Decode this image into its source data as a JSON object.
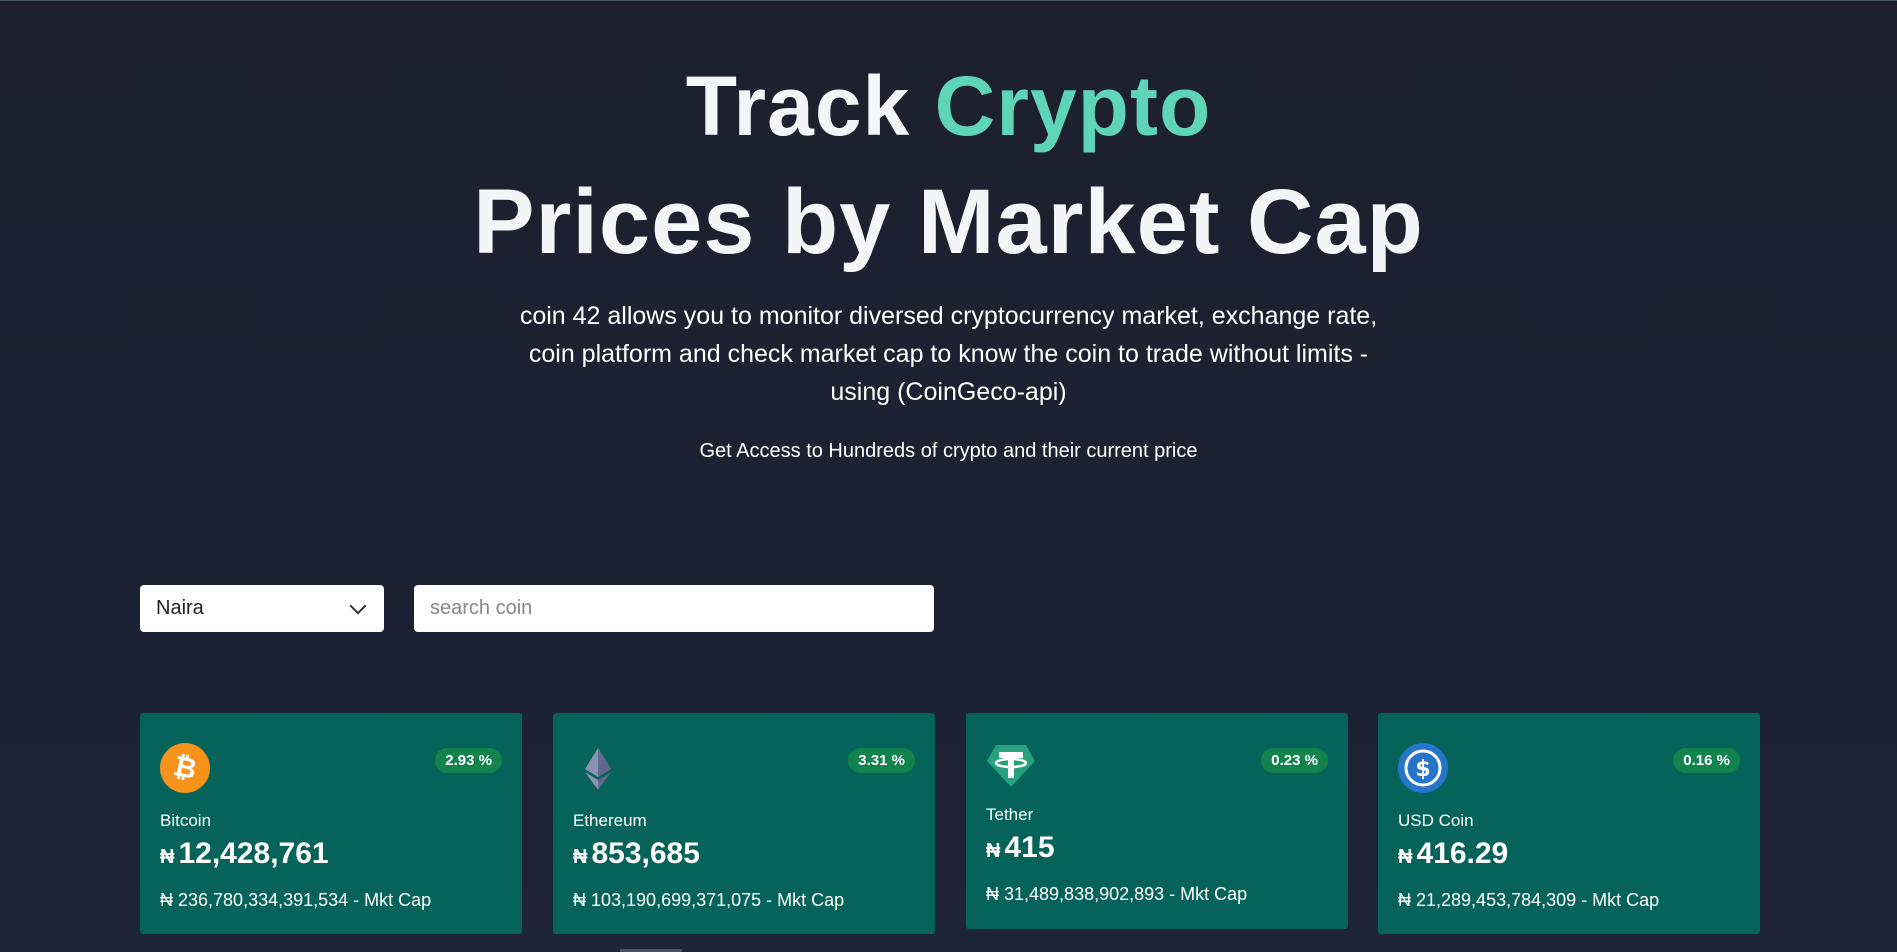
{
  "hero": {
    "title_part1": "Track",
    "title_accent": "Crypto",
    "title_line2": "Prices by Market Cap",
    "description": "coin 42 allows you to monitor diversed cryptocurrency market, exchange rate, coin platform and check market cap to know the coin to trade without limits - using (CoinGeco-api)",
    "tagline": "Get Access to Hundreds of crypto and their current price"
  },
  "controls": {
    "currency_selected": "Naira",
    "search_placeholder": "search coin"
  },
  "currency_symbol": "₦",
  "coins": [
    {
      "name": "Bitcoin",
      "change": "2.93 %",
      "price": "12,428,761",
      "market_cap": "₦ 236,780,334,391,534 - Mkt Cap",
      "icon": "bitcoin-icon",
      "color": "#f7931a"
    },
    {
      "name": "Ethereum",
      "change": "3.31 %",
      "price": "853,685",
      "market_cap": "₦ 103,190,699,371,075 - Mkt Cap",
      "icon": "ethereum-icon",
      "color": "#627eea"
    },
    {
      "name": "Tether",
      "change": "0.23 %",
      "price": "415",
      "market_cap": "₦ 31,489,838,902,893 - Mkt Cap",
      "icon": "tether-icon",
      "color": "#26a17b"
    },
    {
      "name": "USD Coin",
      "change": "0.16 %",
      "price": "416.29",
      "market_cap": "₦ 21,289,453,784,309 - Mkt Cap",
      "icon": "usd-coin-icon",
      "color": "#2775ca"
    }
  ],
  "colors": {
    "accent": "#5ed5b9",
    "card_bg": "#05635a",
    "badge_bg": "#13834d",
    "page_bg": "#1d2233"
  }
}
